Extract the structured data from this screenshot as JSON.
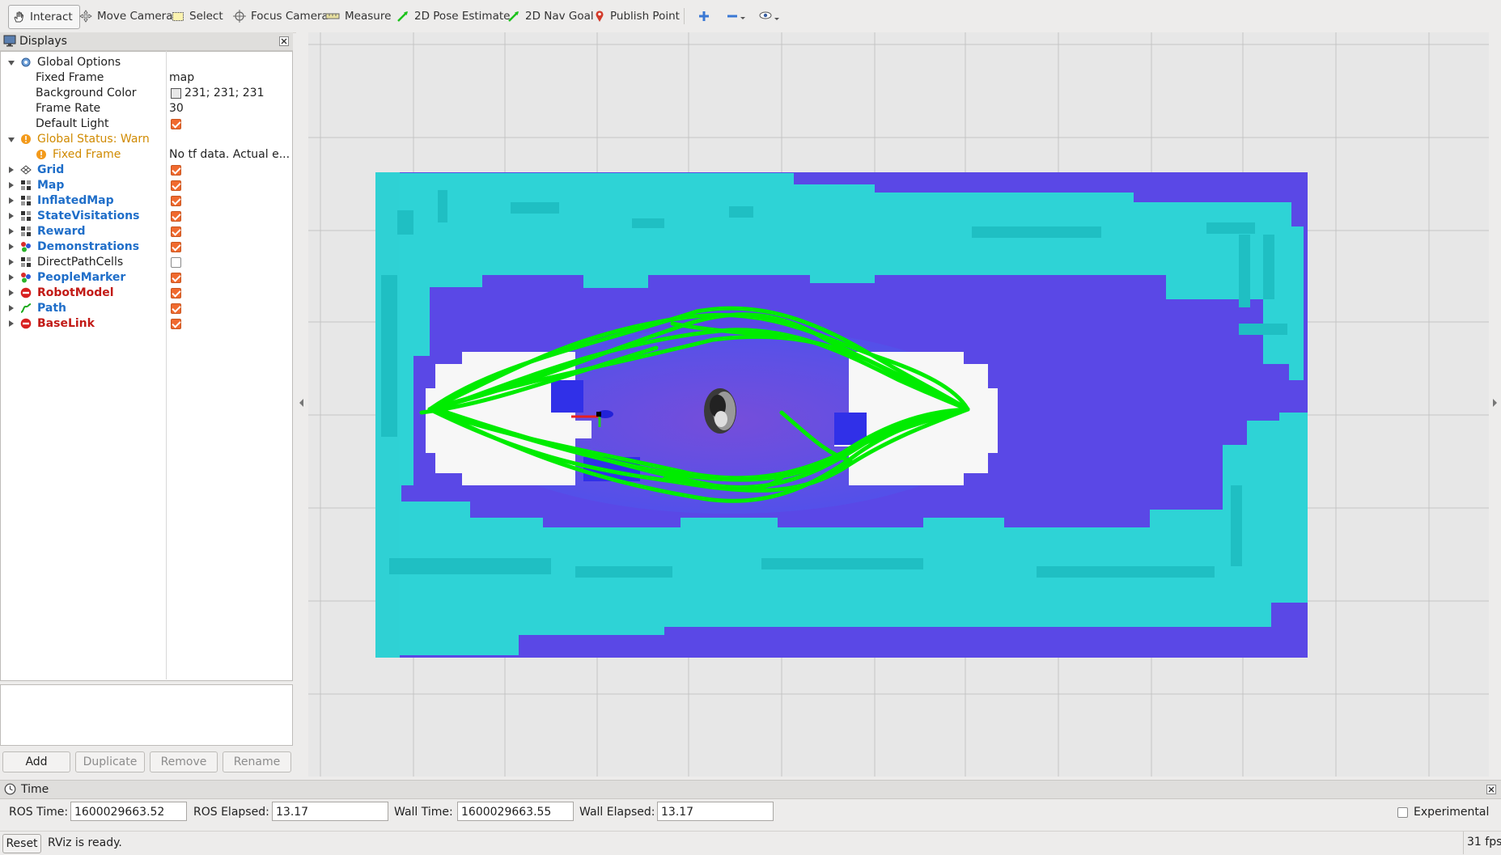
{
  "toolbar": {
    "tools": [
      {
        "label": "Interact",
        "icon": "hand-icon"
      },
      {
        "label": "Move Camera",
        "icon": "move-camera-icon"
      },
      {
        "label": "Select",
        "icon": "select-icon"
      },
      {
        "label": "Focus Camera",
        "icon": "focus-camera-icon"
      },
      {
        "label": "Measure",
        "icon": "measure-icon"
      },
      {
        "label": "2D Pose Estimate",
        "icon": "green-arrow-icon"
      },
      {
        "label": "2D Nav Goal",
        "icon": "green-arrow-icon"
      },
      {
        "label": "Publish Point",
        "icon": "map-pin-icon"
      }
    ]
  },
  "displays": {
    "title": "Displays",
    "global_options": {
      "label": "Global Options",
      "fixed_frame_label": "Fixed Frame",
      "fixed_frame_value": "map",
      "background_color_label": "Background Color",
      "background_color_value": "231; 231; 231",
      "frame_rate_label": "Frame Rate",
      "frame_rate_value": "30",
      "default_light_label": "Default Light"
    },
    "global_status": {
      "label": "Global Status: Warn",
      "fixed_frame_label": "Fixed Frame",
      "fixed_frame_value": "No tf data.  Actual e..."
    },
    "items": [
      {
        "label": "Grid",
        "enabled": true,
        "style": "blue"
      },
      {
        "label": "Map",
        "enabled": true,
        "style": "blue"
      },
      {
        "label": "InflatedMap",
        "enabled": true,
        "style": "blue"
      },
      {
        "label": "StateVisitations",
        "enabled": true,
        "style": "blue"
      },
      {
        "label": "Reward",
        "enabled": true,
        "style": "blue"
      },
      {
        "label": "Demonstrations",
        "enabled": true,
        "style": "blue"
      },
      {
        "label": "DirectPathCells",
        "enabled": false,
        "style": "normal"
      },
      {
        "label": "PeopleMarker",
        "enabled": true,
        "style": "blue"
      },
      {
        "label": "RobotModel",
        "enabled": true,
        "style": "red"
      },
      {
        "label": "Path",
        "enabled": true,
        "style": "blue"
      },
      {
        "label": "BaseLink",
        "enabled": true,
        "style": "red"
      }
    ],
    "buttons": {
      "add": "Add",
      "duplicate": "Duplicate",
      "remove": "Remove",
      "rename": "Rename"
    }
  },
  "time": {
    "title": "Time",
    "ros_time_label": "ROS Time:",
    "ros_time_value": "1600029663.52",
    "ros_elapsed_label": "ROS Elapsed:",
    "ros_elapsed_value": "13.17",
    "wall_time_label": "Wall Time:",
    "wall_time_value": "1600029663.55",
    "wall_elapsed_label": "Wall Elapsed:",
    "wall_elapsed_value": "13.17",
    "experimental_label": "Experimental"
  },
  "status": {
    "reset_label": "Reset",
    "message": "RViz is ready.",
    "fps": "31 fps"
  },
  "colors": {
    "viewport_bg": "#e7e7e7",
    "costmap_cyan": "#2ed6d6",
    "costmap_blue": "#4a4ae8",
    "free_space": "#f7f7f7",
    "path_green": "#00ee00"
  }
}
